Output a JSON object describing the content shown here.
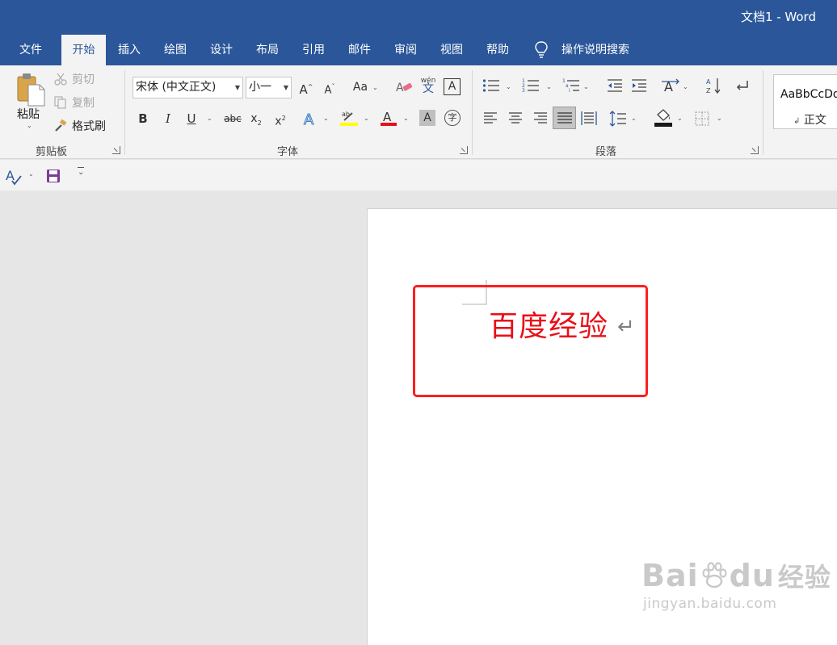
{
  "window": {
    "title": "文档1  -  Word"
  },
  "tabs": [
    {
      "label": "文件",
      "active": false
    },
    {
      "label": "开始",
      "active": true
    },
    {
      "label": "插入",
      "active": false
    },
    {
      "label": "绘图",
      "active": false
    },
    {
      "label": "设计",
      "active": false
    },
    {
      "label": "布局",
      "active": false
    },
    {
      "label": "引用",
      "active": false
    },
    {
      "label": "邮件",
      "active": false
    },
    {
      "label": "审阅",
      "active": false
    },
    {
      "label": "视图",
      "active": false
    },
    {
      "label": "帮助",
      "active": false
    }
  ],
  "tell_me": {
    "label": "操作说明搜索",
    "icon": "lightbulb-icon"
  },
  "clipboard": {
    "paste_label": "粘贴",
    "cut_label": "剪切",
    "copy_label": "复制",
    "format_painter_label": "格式刷",
    "group_label": "剪贴板"
  },
  "font": {
    "font_name": "宋体 (中文正文)",
    "font_size": "小一",
    "change_case_label": "Aa",
    "bold": "B",
    "italic": "I",
    "underline": "U",
    "strikethrough": "abc",
    "phonetic_top": "wén",
    "phonetic_bottom": "文",
    "border_char": "A",
    "shading_char": "A",
    "enclose_char": "字",
    "highlight_color": "#ffff00",
    "font_color": "#e8101a",
    "group_label": "字体"
  },
  "paragraph": {
    "group_label": "段落",
    "shading_color": "#1a1a1a"
  },
  "styles": {
    "sample": "AaBbCcDd",
    "name": "正文",
    "mark": "↲"
  },
  "document": {
    "text": "百度经验",
    "text_color": "#e8101a",
    "paragraph_mark": "↵",
    "highlight_box_color": "#ff1e1e"
  },
  "watermark": {
    "brand": "Bai",
    "brand_tail": "du",
    "cn": "经验",
    "url": "jingyan.baidu.com"
  },
  "colors": {
    "accent": "#2b579a",
    "ribbon_bg": "#f3f3f3",
    "workspace_bg": "#e6e6e6"
  }
}
